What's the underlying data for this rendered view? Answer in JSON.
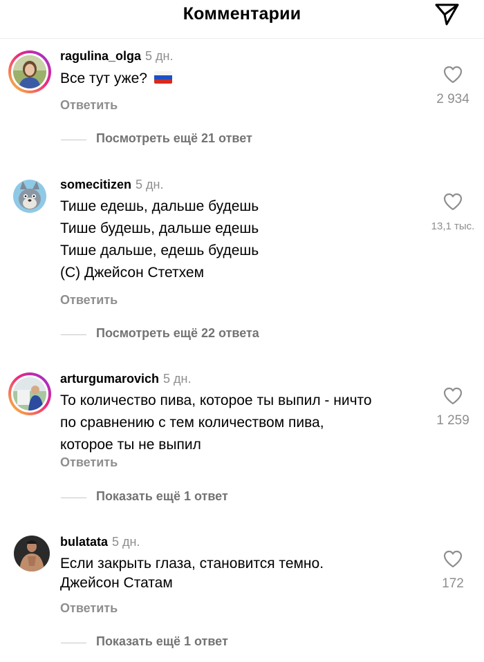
{
  "header": {
    "title": "Комментарии",
    "share_icon": "paper-plane-icon"
  },
  "comments": [
    {
      "username": "ragulina_olga",
      "time": "5 дн.",
      "lines": [
        "Все тут уже?"
      ],
      "emoji": "russia-flag",
      "reply_label": "Ответить",
      "likes": "2 934",
      "more_replies": "Посмотреть ещё 21 ответ"
    },
    {
      "username": "somecitizen",
      "time": "5 дн.",
      "lines": [
        "Тише едешь, дальше будешь",
        "Тише будешь, дальше едешь",
        "Тише дальше, едешь будешь",
        "(C) Джейсон Стетхем"
      ],
      "reply_label": "Ответить",
      "likes": "13,1 тыс.",
      "more_replies": "Посмотреть ещё 22 ответа"
    },
    {
      "username": "arturgumarovich",
      "time": "5 дн.",
      "lines": [
        "То количество пива,  которое ты выпил - ничто",
        "по сравнению с тем количеством пива,",
        "которое ты не выпил"
      ],
      "reply_label": "Ответить",
      "likes": "1 259",
      "more_replies": "Показать ещё 1 ответ"
    },
    {
      "username": "bulatata",
      "time": "5 дн.",
      "lines": [
        "Если закрыть глаза, становится темно.",
        "Джейсон Статам"
      ],
      "reply_label": "Ответить",
      "likes": "172",
      "more_replies": "Показать ещё 1 ответ"
    }
  ],
  "colors": {
    "secondary_text": "#8e8e8e",
    "divider": "#c7c7c7",
    "story_ring": "#ee2a7b"
  }
}
